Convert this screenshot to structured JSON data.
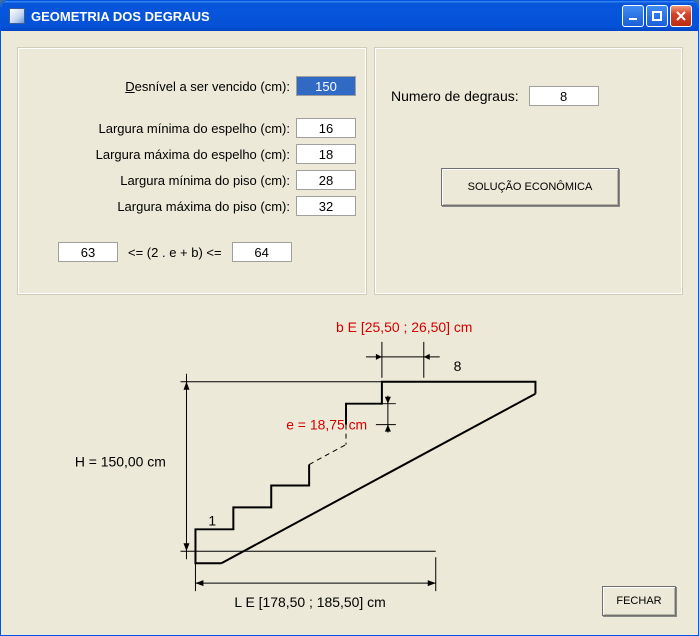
{
  "window": {
    "title": "GEOMETRIA DOS DEGRAUS"
  },
  "left_panel": {
    "desnivel_label": "esnível a ser vencido (cm):",
    "desnivel_prefix": "D",
    "desnivel_value": "150",
    "larg_min_espelho_label": "Largura mínima do espelho (cm):",
    "larg_min_espelho_value": "16",
    "larg_max_espelho_label": "Largura máxima do espelho (cm):",
    "larg_max_espelho_value": "18",
    "larg_min_piso_label": "Largura mínima do piso (cm):",
    "larg_min_piso_value": "28",
    "larg_max_piso_label": "Largura máxima do piso (cm):",
    "larg_max_piso_value": "32",
    "formula_left_value": "63",
    "formula_mid": "<= (2 . e + b) <=",
    "formula_right_value": "64"
  },
  "right_panel": {
    "num_degraus_label": "Numero de degraus:",
    "num_degraus_value": "8",
    "btn_solucao": "SOLUÇÃO ECONÔMICA"
  },
  "diagram": {
    "b_label": "b E [25,50 ; 26,50] cm",
    "e_label": "e = 18,75 cm",
    "H_label": "H = 150,00 cm",
    "L_label": "L E [178,50 ; 185,50] cm",
    "step_first": "1",
    "step_last": "8"
  },
  "footer": {
    "btn_fechar": "FECHAR"
  }
}
